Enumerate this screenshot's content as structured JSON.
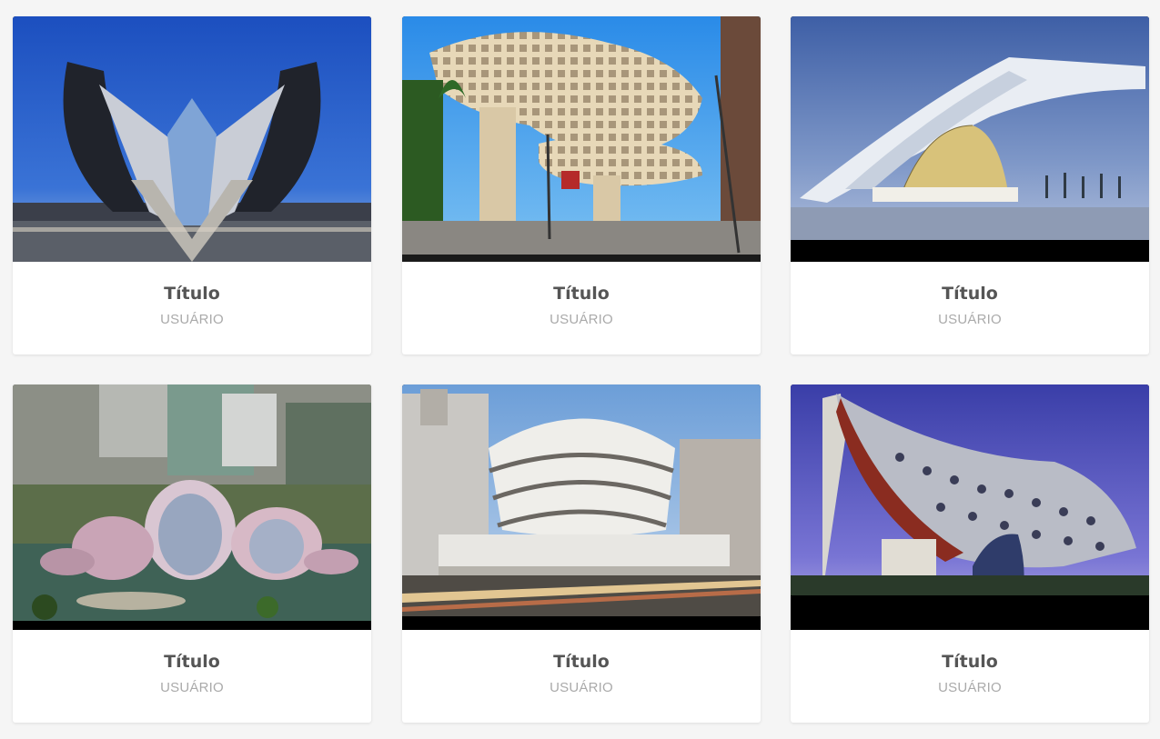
{
  "cards": [
    {
      "title": "Título",
      "user": "USUÁRIO",
      "image": "calatrava-station-wings"
    },
    {
      "title": "Título",
      "user": "USUÁRIO",
      "image": "metropol-parasol-seville"
    },
    {
      "title": "Título",
      "user": "USUÁRIO",
      "image": "museum-of-tomorrow-rio"
    },
    {
      "title": "Título",
      "user": "USUÁRIO",
      "image": "lotus-building-wujin"
    },
    {
      "title": "Título",
      "user": "USUÁRIO",
      "image": "guggenheim-new-york"
    },
    {
      "title": "Título",
      "user": "USUÁRIO",
      "image": "hotel-unique-sao-paulo"
    }
  ]
}
